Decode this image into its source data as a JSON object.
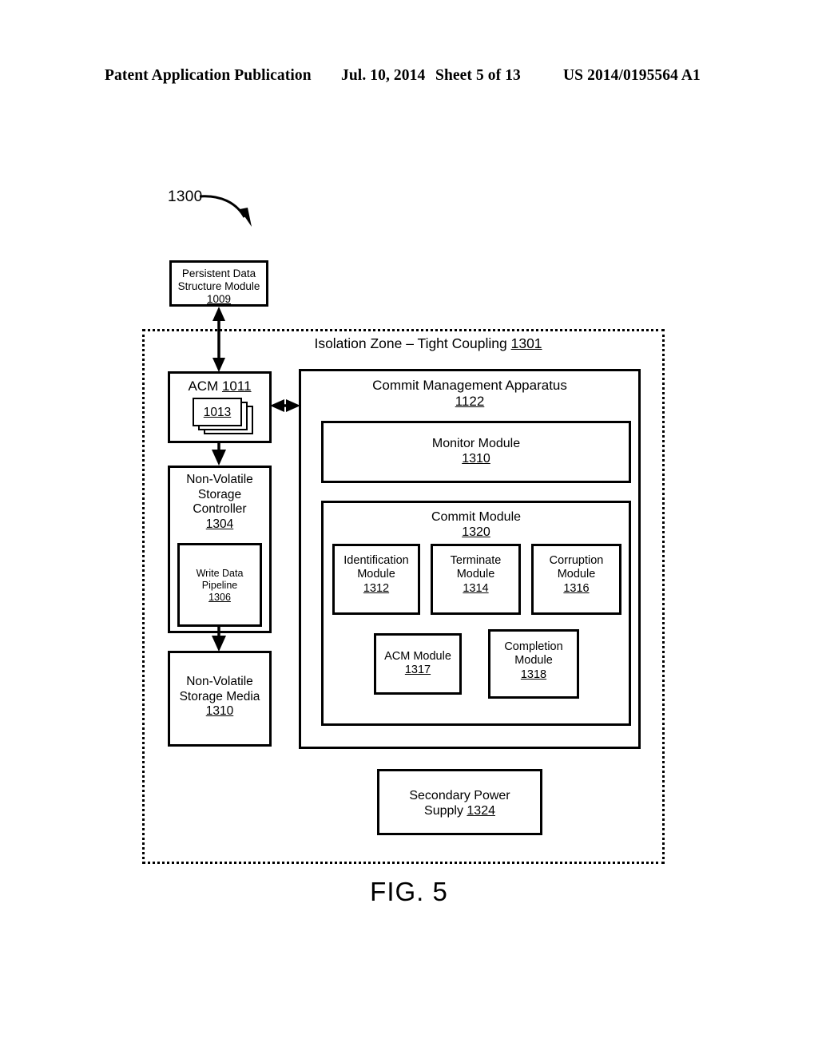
{
  "header": {
    "publication": "Patent Application Publication",
    "date": "Jul. 10, 2014",
    "sheet": "Sheet 5 of 13",
    "patent_number": "US 2014/0195564 A1"
  },
  "figure": {
    "caption": "FIG. 5",
    "callout_label": "1300",
    "isolation_zone": {
      "title": "Isolation Zone – Tight Coupling",
      "ref": "1301"
    },
    "boxes": {
      "persistent_data_structure_module": {
        "line1": "Persistent Data",
        "line2": "Structure Module",
        "ref": "1009"
      },
      "acm": {
        "label": "ACM",
        "ref": "1011",
        "stack_ref": "1013"
      },
      "non_volatile_storage_controller": {
        "line1": "Non-Volatile",
        "line2": "Storage",
        "line3": "Controller",
        "ref": "1304"
      },
      "write_data_pipeline": {
        "line1": "Write Data",
        "line2": "Pipeline",
        "ref": "1306"
      },
      "non_volatile_storage_media": {
        "line1": "Non-Volatile",
        "line2": "Storage Media",
        "ref": "1310"
      },
      "commit_management_apparatus": {
        "title": "Commit Management Apparatus",
        "ref": "1122"
      },
      "monitor_module": {
        "title": "Monitor Module",
        "ref": "1310"
      },
      "commit_module": {
        "title": "Commit Module",
        "ref": "1320"
      },
      "identification_module": {
        "line1": "Identification",
        "line2": "Module",
        "ref": "1312"
      },
      "terminate_module": {
        "line1": "Terminate",
        "line2": "Module",
        "ref": "1314"
      },
      "corruption_module": {
        "line1": "Corruption",
        "line2": "Module",
        "ref": "1316"
      },
      "acm_module": {
        "line1": "ACM Module",
        "ref": "1317"
      },
      "completion_module": {
        "line1": "Completion",
        "line2": "Module",
        "ref": "1318"
      },
      "secondary_power_supply": {
        "line1": "Secondary Power",
        "line2": "Supply",
        "ref": "1324"
      }
    }
  }
}
